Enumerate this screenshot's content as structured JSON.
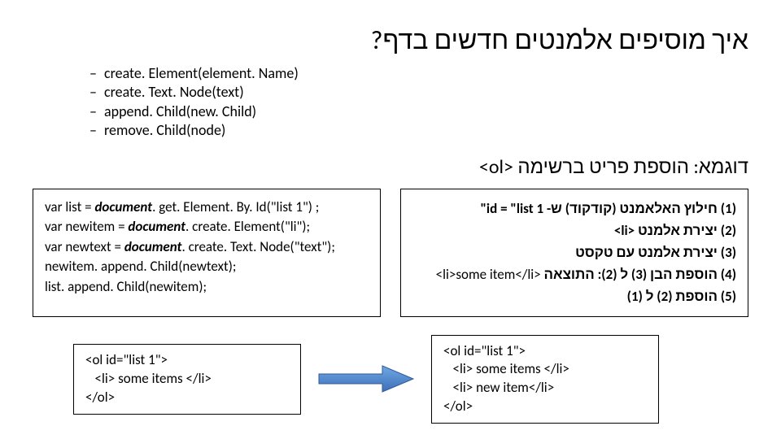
{
  "title": "איך מוסיפים אלמנטים חדשים בדף?",
  "bullets": {
    "b1": "create. Element(element. Name)",
    "b2": "create. Text. Node(text)",
    "b3": "append. Child(new. Child)",
    "b4": "remove. Child(node)"
  },
  "example_title": "דוגמא: הוספת פריט ברשימה <ol>",
  "code": {
    "l1a": "var list = ",
    "l1b": "document",
    "l1c": ". get. Element. By. Id(\"list 1\") ;",
    "l2a": "var newitem = ",
    "l2b": "document",
    "l2c": ". create. Element(\"li\");",
    "l3a": "var newtext = ",
    "l3b": "document",
    "l3c": ". create. Text. Node(\"text\");",
    "l4": "newitem. append. Child(newtext);",
    "l5": "list. append. Child(newitem);"
  },
  "steps": {
    "s1": "(1) חילוץ האלאמנט (קודקוד) ש- id = \"list 1\"",
    "s2": "(2) יצירת אלמנט <li>",
    "s3": "(3) יצירת אלמנט עם טקסט",
    "s4a": "(4) הוספת הבן (3) ל (2): התוצאה ",
    "s4b": "<li>some item</li>",
    "s5": "(5) הוספת (2) ל (1)"
  },
  "snippet_before": "<ol id=\"list 1\">\n   <li> some items </li>\n</ol>",
  "snippet_after": "<ol id=\"list 1\">\n   <li> some items </li>\n   <li> new item</li>\n</ol>"
}
